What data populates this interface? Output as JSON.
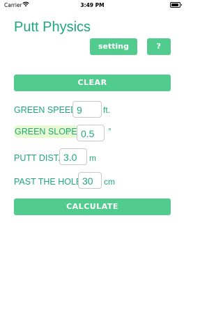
{
  "status_bar": {
    "carrier": "Carrier",
    "time": "3:49 PM"
  },
  "app": {
    "title": "Putt Physics"
  },
  "buttons": {
    "setting": "setting",
    "help": "?",
    "clear": "CLEAR",
    "calculate": "CALCULATE"
  },
  "form": {
    "green_speed": {
      "label": "GREEN SPEED:",
      "value": "9",
      "unit": "ft."
    },
    "green_slope": {
      "label": "GREEN SLOPE",
      "separator": ":",
      "value": "0.5",
      "unit": "°"
    },
    "putt_dist": {
      "label": "PUTT DIST.:",
      "value": "3.0",
      "unit": "m"
    },
    "past_hole": {
      "label": "PAST THE HOLE:",
      "value": "30",
      "unit": "cm"
    }
  },
  "colors": {
    "accent_text": "#1ea878",
    "button": "#52cc8e",
    "highlight": "#e9f9d2"
  }
}
